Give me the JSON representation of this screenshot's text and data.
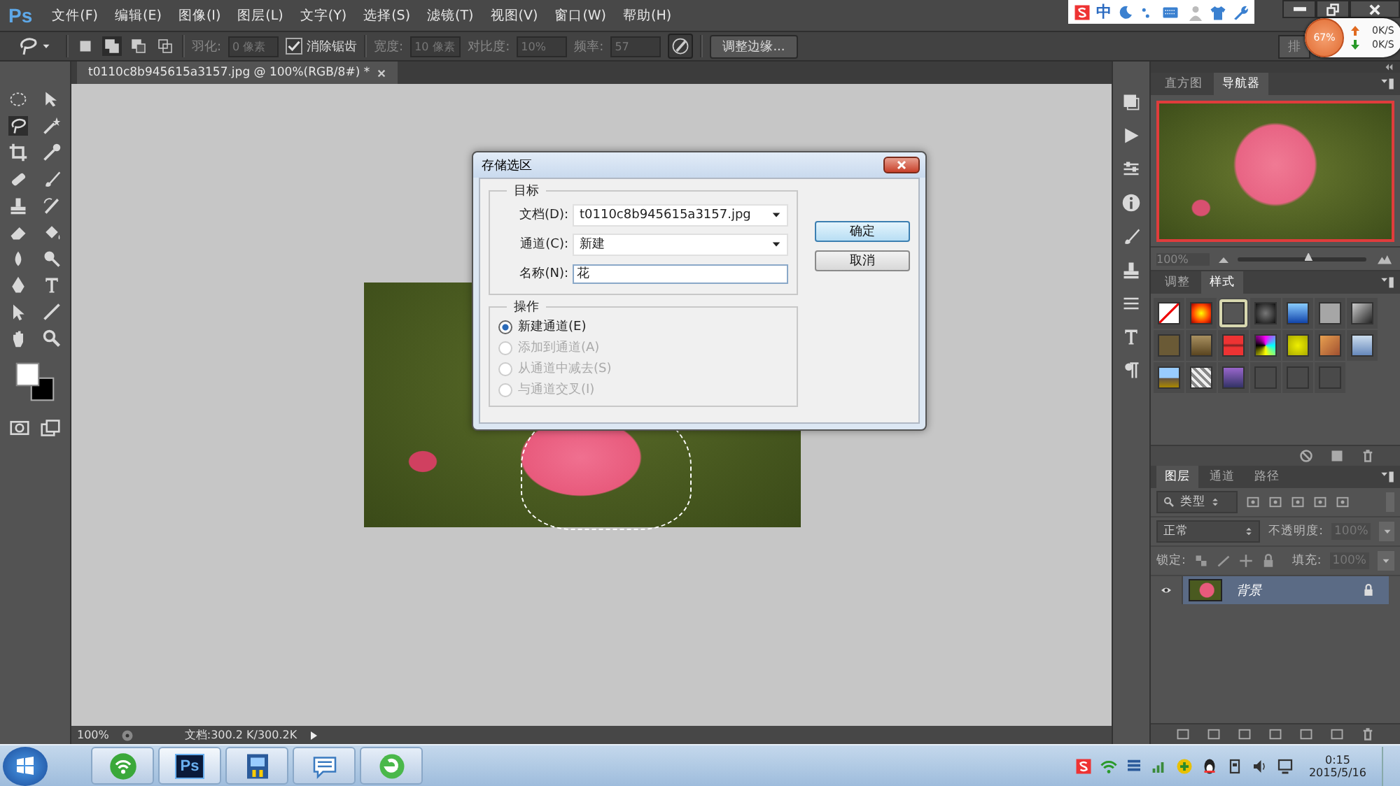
{
  "app": {
    "logo": "Ps"
  },
  "menu": [
    "文件(F)",
    "编辑(E)",
    "图像(I)",
    "图层(L)",
    "文字(Y)",
    "选择(S)",
    "滤镜(T)",
    "视图(V)",
    "窗口(W)",
    "帮助(H)"
  ],
  "ime_toolbar": {
    "mode": "中"
  },
  "options_bar": {
    "feather_label": "羽化:",
    "feather_value": "0 像素",
    "antialias": {
      "label": "消除锯齿",
      "checked": true
    },
    "width_label": "宽度:",
    "width_value": "10 像素",
    "contrast_label": "对比度:",
    "contrast_value": "10%",
    "frequency_label": "频率:",
    "frequency_value": "57",
    "refine_button": "调整边缘...",
    "partial_button": "排"
  },
  "network_widget": {
    "percent": "67%",
    "upload": "0K/S",
    "download": "0K/S"
  },
  "document_tab": {
    "title": "t0110c8b945615a3157.jpg @ 100%(RGB/8#) *"
  },
  "dialog": {
    "title": "存储选区",
    "target_legend": "目标",
    "fields": [
      {
        "kind": "dropdown",
        "label": "文档(D):",
        "value": "t0110c8b945615a3157.jpg"
      },
      {
        "kind": "dropdown",
        "label": "通道(C):",
        "value": "新建"
      },
      {
        "kind": "text",
        "label": "名称(N):",
        "value": "花"
      }
    ],
    "operation_legend": "操作",
    "operations": [
      {
        "label": "新建通道(E)",
        "selected": true,
        "disabled": false
      },
      {
        "label": "添加到通道(A)",
        "selected": false,
        "disabled": true
      },
      {
        "label": "从通道中减去(S)",
        "selected": false,
        "disabled": true
      },
      {
        "label": "与通道交叉(I)",
        "selected": false,
        "disabled": true
      }
    ],
    "buttons": [
      {
        "label": "确定",
        "default": true
      },
      {
        "label": "取消",
        "default": false
      }
    ]
  },
  "status_bar": {
    "zoom": "100%",
    "doc_info": "文档:300.2 K/300.2K"
  },
  "navigator": {
    "tabs": [
      {
        "label": "直方图",
        "selected": false
      },
      {
        "label": "导航器",
        "selected": true
      }
    ],
    "zoom": "100%",
    "level": 0.55
  },
  "styles_panel": {
    "tabs": [
      {
        "label": "调整",
        "selected": false
      },
      {
        "label": "样式",
        "selected": true
      }
    ]
  },
  "layers_panel": {
    "tabs": [
      {
        "label": "图层",
        "selected": true
      },
      {
        "label": "通道",
        "selected": false
      },
      {
        "label": "路径",
        "selected": false
      }
    ],
    "filter": "类型",
    "blend_mode": "正常",
    "opacity_label": "不透明度:",
    "opacity_value": "100%",
    "lock_label": "锁定:",
    "fill_label": "填充:",
    "fill_value": "100%",
    "layers": [
      {
        "name": "背景",
        "visible": true,
        "locked": true,
        "selected": true
      }
    ]
  },
  "taskbar": {
    "ps_label": "Ps",
    "time": "0:15",
    "date": "2015/5/16"
  }
}
